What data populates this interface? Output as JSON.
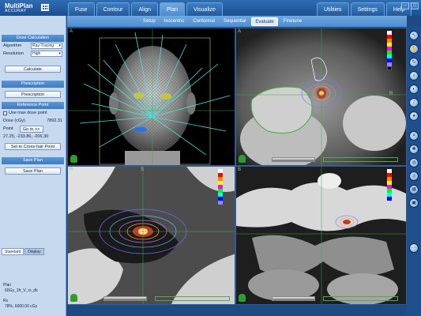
{
  "app": {
    "name": "MultiPlan",
    "sub": "ACCURAY"
  },
  "main_tabs": [
    "Fuse",
    "Contour",
    "Align",
    "Plan",
    "Visualize"
  ],
  "active_tab": "Plan",
  "right_tabs": [
    "Utilities",
    "Settings",
    "Help"
  ],
  "window_buttons": [
    "–",
    "□"
  ],
  "sub_tabs": [
    "Setup",
    "Isocentric",
    "Conformal",
    "Sequential",
    "Evaluate",
    "Finetune"
  ],
  "active_sub_tab": "Evaluate",
  "dose_calc": {
    "header": "Dose Calculation",
    "algorithm_label": "Algorithm",
    "algorithm_value": "Ray-Tracing",
    "resolution_label": "Resolution",
    "resolution_value": "High",
    "calculate": "Calculate"
  },
  "prescription": {
    "header": "Prescription",
    "button": "Prescription"
  },
  "reference": {
    "header": "Reference Point",
    "use_max": "Use max dose point",
    "dose_label": "Dose (cGy)",
    "dose_value": "7892.31",
    "point_label": "Point",
    "goto": "Go to >>",
    "coords": "27.25, -233.86, -206.30",
    "crosshair": "Set to Cross-hair Point"
  },
  "save": {
    "header": "Save Plan",
    "button": "Save Plan"
  },
  "panel_tabs": [
    "Standard",
    "Display"
  ],
  "plan_info": {
    "plan_label": "Plan",
    "plan_name": "60Gy_1fr_V_rx_dk",
    "rx_label": "Rx",
    "rx_value": "78%, 6000.00 cGy"
  },
  "viewports": {
    "top_left": "A",
    "top_right": "A",
    "bottom_left": "R",
    "bottom_right": "B",
    "top_right_marker": "R",
    "bottom_left_marker": "S"
  },
  "colors": {
    "accent": "#2f6db3",
    "panel": "#c7d9ee",
    "crosshair": "#3fae3f",
    "beam": "#49e3e0"
  },
  "right_icons": [
    "cursor-icon",
    "hand-icon",
    "rotate-icon",
    "zoom-icon",
    "window-level-icon",
    "measure-icon",
    "contour-icon",
    "visibility-icon",
    "beam-icon",
    "dose-icon",
    "target-icon",
    "layout-icon",
    "screenshot-icon",
    "help-icon"
  ]
}
